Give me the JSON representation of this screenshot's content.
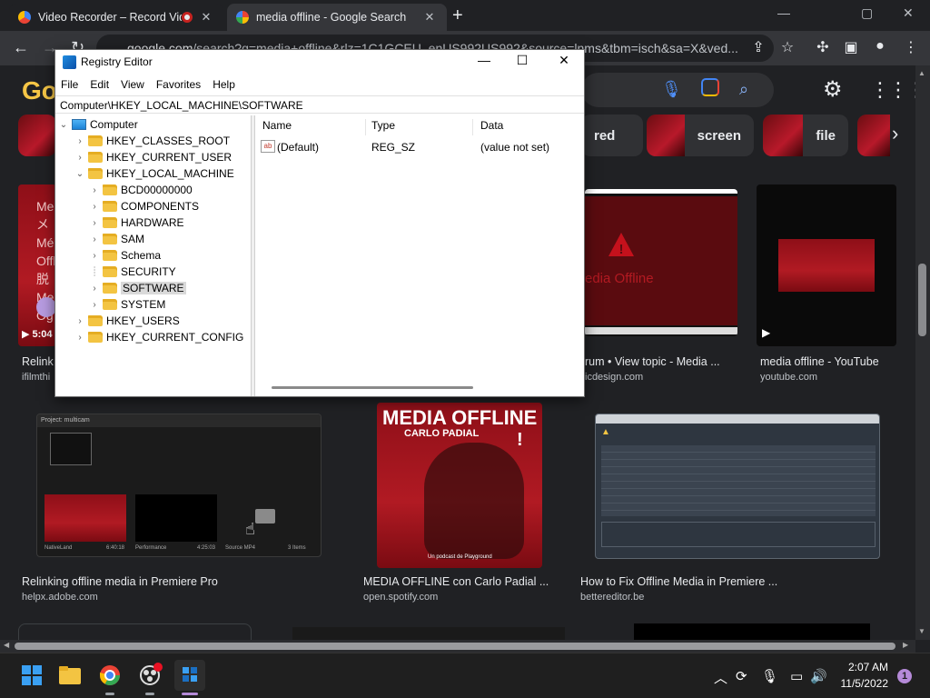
{
  "browser": {
    "tabs": [
      {
        "title": "Video Recorder – Record Vid",
        "active": false,
        "recording": true
      },
      {
        "title": "media offline - Google Search",
        "active": true
      }
    ],
    "new_tab": "+",
    "window_controls": {
      "minimize": "—",
      "maximize": "▢",
      "close": "✕"
    },
    "nav": {
      "back": "←",
      "forward": "→",
      "reload": "↻"
    },
    "omnibox": {
      "host": "google.com",
      "path": "/search?q=media+offline&rlz=1C1GCEU_enUS992US992&source=lnms&tbm=isch&sa=X&ved..."
    }
  },
  "google": {
    "logo": "Go",
    "chips": [
      {
        "label": "red"
      },
      {
        "label": "screen"
      },
      {
        "label": "file"
      }
    ],
    "chip_next": "›",
    "results_row1": [
      {
        "badge_time": "5:04",
        "title": "Relink",
        "source": "ifilmthi"
      },
      {
        "image_text": "edia Offline",
        "title": "rum • View topic - Media ...",
        "source": "icdesign.com"
      },
      {
        "title": "media offline - YouTube",
        "source": "youtube.com"
      }
    ],
    "results_row2": [
      {
        "title": "Relinking offline media in Premiere Pro",
        "source": "helpx.adobe.com"
      },
      {
        "image_title": "MEDIA OFFLINE",
        "image_subtitle": "CARLO PADIAL",
        "image_footer": "Un podcast de Playground",
        "title": "MEDIA OFFLINE con Carlo Padial ...",
        "source": "open.spotify.com"
      },
      {
        "title": "How to Fix Offline Media in Premiere ...",
        "source": "bettereditor.be"
      }
    ],
    "premiere_panel": {
      "tab": "Project: multicam",
      "clip1": "NativeLand",
      "clip1_dur": "6:40:18",
      "clip2": "Performance",
      "clip2_dur": "4:25:03",
      "clip3": "Source MP4",
      "items": "3 Items"
    }
  },
  "regedit": {
    "title": "Registry Editor",
    "menu": [
      "File",
      "Edit",
      "View",
      "Favorites",
      "Help"
    ],
    "address": "Computer\\HKEY_LOCAL_MACHINE\\SOFTWARE",
    "tree": {
      "root": "Computer",
      "hives": [
        "HKEY_CLASSES_ROOT",
        "HKEY_CURRENT_USER",
        "HKEY_LOCAL_MACHINE"
      ],
      "hklm_children": [
        "BCD00000000",
        "COMPONENTS",
        "HARDWARE",
        "SAM",
        "Schema",
        "SECURITY",
        "SOFTWARE",
        "SYSTEM"
      ],
      "hives_after": [
        "HKEY_USERS",
        "HKEY_CURRENT_CONFIG"
      ]
    },
    "columns": {
      "name": "Name",
      "type": "Type",
      "data": "Data"
    },
    "values": [
      {
        "name": "(Default)",
        "type": "REG_SZ",
        "data": "(value not set)",
        "icon": "ab"
      }
    ],
    "window_controls": {
      "minimize": "—",
      "maximize": "☐",
      "close": "✕"
    }
  },
  "taskbar": {
    "apps": [
      "start",
      "file-explorer",
      "chrome",
      "obs",
      "regedit"
    ],
    "time": "2:07 AM",
    "date": "11/5/2022",
    "notifications": "1"
  }
}
